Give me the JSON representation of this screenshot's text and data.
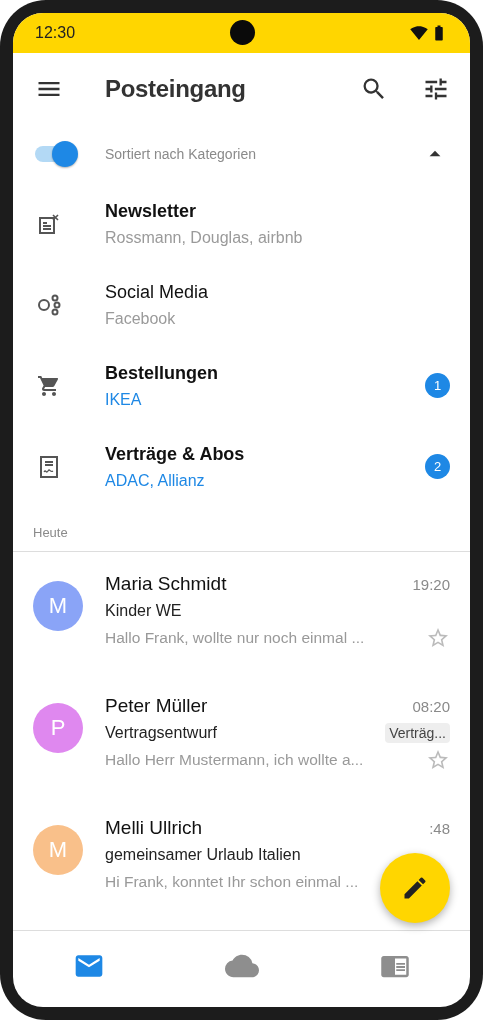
{
  "status_bar": {
    "time": "12:30"
  },
  "app_bar": {
    "title": "Posteingang"
  },
  "sort_toggle": {
    "label": "Sortiert nach Kategorien",
    "on": true,
    "expanded": true
  },
  "categories": [
    {
      "kind": "newsletter",
      "title": "Newsletter",
      "senders": "Rossmann, Douglas, airbnb",
      "unread": true
    },
    {
      "kind": "social",
      "title": "Social Media",
      "senders": "Facebook",
      "unread": false
    },
    {
      "kind": "orders",
      "title": "Bestellungen",
      "senders": "IKEA",
      "unread": true,
      "count": "1"
    },
    {
      "kind": "contracts",
      "title": "Verträge & Abos",
      "senders": "ADAC, Allianz",
      "unread": true,
      "count": "2"
    }
  ],
  "section_header": "Heute",
  "emails": [
    {
      "initial": "M",
      "color": "#8aa4f7",
      "sender": "Maria Schmidt",
      "time": "19:20",
      "subject": "Kinder WE",
      "preview": "Hallo Frank, wollte nur noch einmal ...",
      "starred": false
    },
    {
      "initial": "P",
      "color": "#df88ef",
      "sender": "Peter Müller",
      "time": "08:20",
      "subject": "Vertragsentwurf",
      "label": "Verträg...",
      "preview": "Hallo Herr Mustermann, ich wollte a...",
      "starred": false
    },
    {
      "initial": "M",
      "color": "#f9c08a",
      "sender": "Melli Ullrich",
      "time": ":48",
      "subject": "gemeinsamer Urlaub Italien",
      "preview": "Hi Frank, konntet Ihr schon einmal ..."
    }
  ],
  "bottom_nav": [
    {
      "kind": "mail",
      "selected": true
    },
    {
      "kind": "cloud",
      "selected": false
    },
    {
      "kind": "news",
      "selected": false
    }
  ]
}
